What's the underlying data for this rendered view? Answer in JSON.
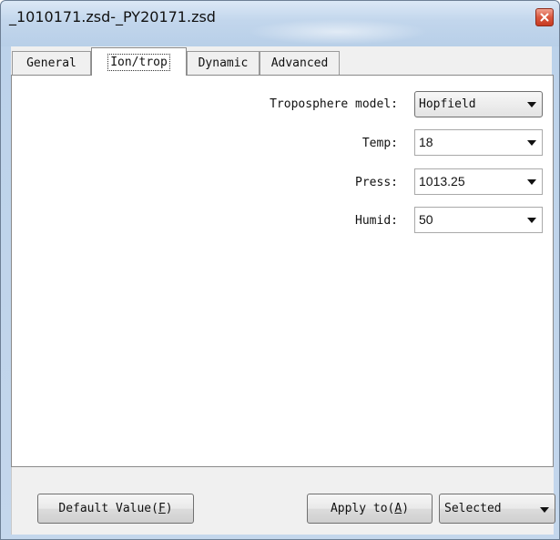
{
  "window": {
    "title": "_1010171.zsd-_PY20171.zsd"
  },
  "tabs": [
    {
      "label": "General",
      "active": false
    },
    {
      "label": "Ion/trop",
      "active": true
    },
    {
      "label": "Dynamic",
      "active": false
    },
    {
      "label": "Advanced",
      "active": false
    }
  ],
  "form": {
    "troposphere_model": {
      "label": "Troposphere model:",
      "value": "Hopfield"
    },
    "temp": {
      "label": "Temp:",
      "value": "18"
    },
    "press": {
      "label": "Press:",
      "value": "1013.25"
    },
    "humid": {
      "label": "Humid:",
      "value": "50"
    }
  },
  "footer": {
    "default_value": {
      "text": "Default Value(",
      "accel": "F",
      "close": ")"
    },
    "apply_to": {
      "text": "Apply to(",
      "accel": "A",
      "close": ")"
    },
    "apply_target": {
      "value": "Selected"
    }
  },
  "icons": {
    "close": "close-icon",
    "dropdown": "chevron-down-icon"
  },
  "colors": {
    "close_button": "#d9583f",
    "titlebar": "#c2d6ec"
  }
}
